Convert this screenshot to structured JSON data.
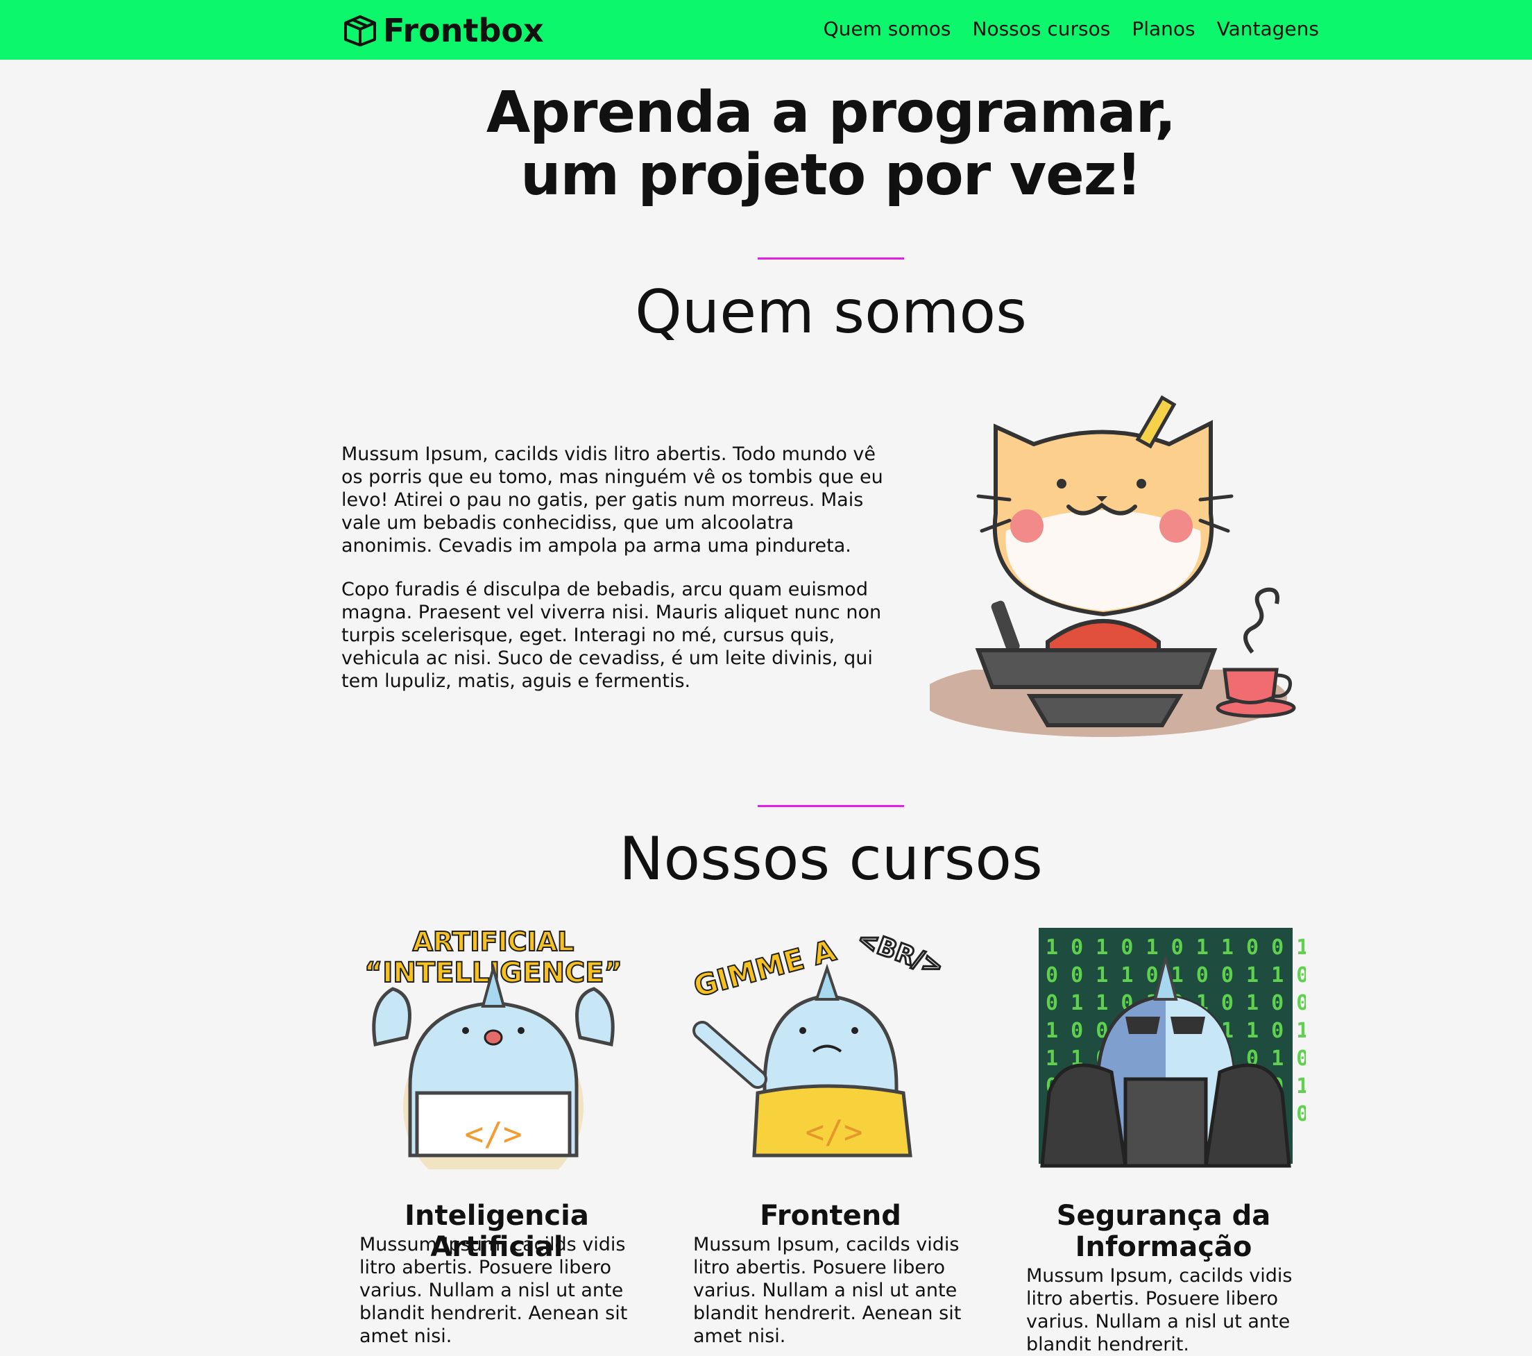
{
  "brand": {
    "name": "Frontbox",
    "logo_icon": "box-icon"
  },
  "nav": {
    "items": [
      {
        "label": "Quem somos"
      },
      {
        "label": "Nossos cursos"
      },
      {
        "label": "Planos"
      },
      {
        "label": "Vantagens"
      }
    ]
  },
  "hero": {
    "line1": "Aprenda a programar,",
    "line2": "um projeto por vez!"
  },
  "about": {
    "title": "Quem somos",
    "paragraphs": [
      "Mussum Ipsum, cacilds vidis litro abertis. Todo mundo vê os porris que eu tomo, mas ninguém vê os tombis que eu levo! Atirei o pau no gatis, per gatis num morreus. Mais vale um bebadis conhecidiss, que um alcoolatra anonimis. Cevadis im ampola pa arma uma pindureta.",
      "Copo furadis é disculpa de bebadis, arcu quam euismod magna. Praesent vel viverra nisi. Mauris aliquet nunc non turpis scelerisque, eget. Interagi no mé, cursus quis, vehicula ac nisi. Suco de cevadiss, é um leite divinis, qui tem lupuliz, matis, aguis e fermentis."
    ]
  },
  "courses": {
    "title": "Nossos cursos",
    "items": [
      {
        "title": "Inteligencia Artificial",
        "sticker_text": [
          "ARTIFICIAL",
          "“INTELLIGENCE”"
        ],
        "desc": "Mussum Ipsum, cacilds vidis litro abertis. Posuere libero varius. Nullam a nisl ut ante blandit hendrerit. Aenean sit amet nisi."
      },
      {
        "title": "Frontend",
        "sticker_text": [
          "GIMME A",
          "<BR/>"
        ],
        "desc": "Mussum Ipsum, cacilds vidis litro abertis. Posuere libero varius. Nullam a nisl ut ante blandit hendrerit. Aenean sit amet nisi."
      },
      {
        "title": "Segurança da Informação",
        "sticker_text": [],
        "desc": "Mussum Ipsum, cacilds vidis litro abertis. Posuere libero varius. Nullam a nisl ut ante blandit hendrerit."
      }
    ]
  },
  "colors": {
    "nav_bg": "#0cf76b",
    "accent_divider": "#e31ee8",
    "page_bg": "#f5f5f5"
  }
}
